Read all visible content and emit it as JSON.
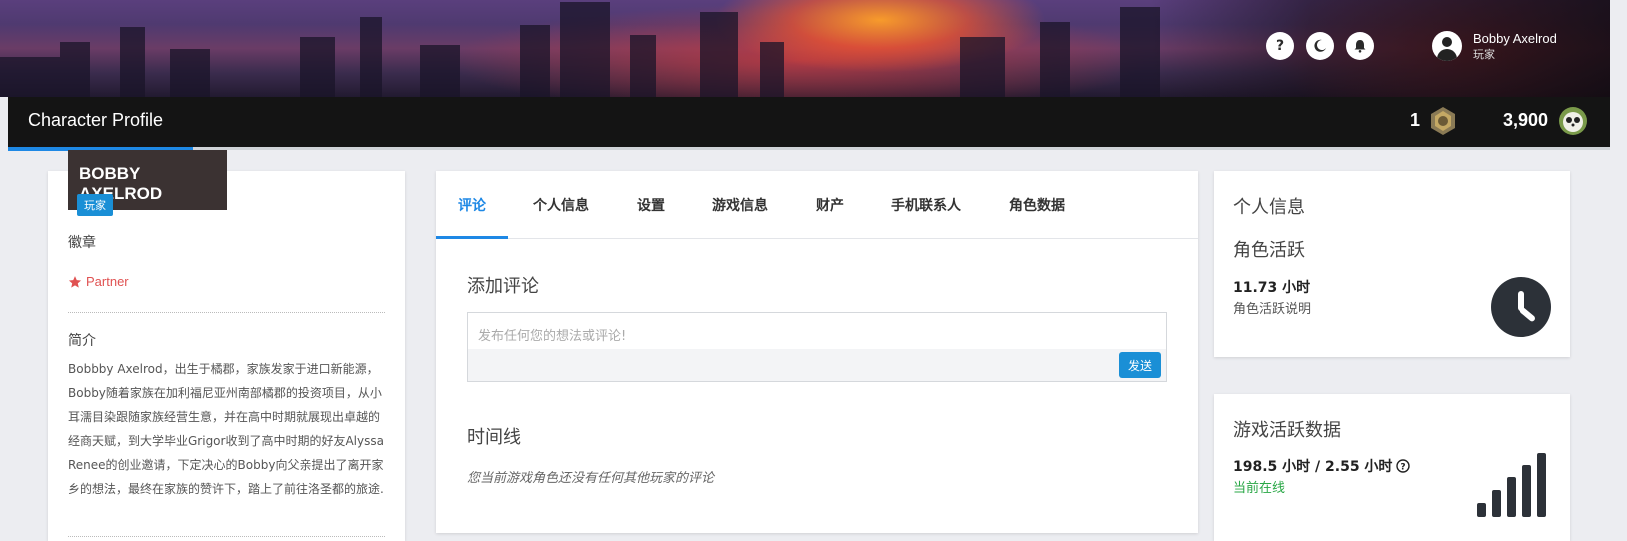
{
  "header": {
    "icons": [
      "question-icon",
      "moon-icon",
      "bell-icon"
    ],
    "user_name": "Bobby Axelrod",
    "user_role": "玩家"
  },
  "titlebar": {
    "title": "Character Profile",
    "badge_count": "1",
    "coins": "3,900"
  },
  "profile": {
    "name": "BOBBY AXELROD",
    "role_badge": "玩家",
    "badges_label": "徽章",
    "partner_label": "Partner",
    "intro_label": "简介",
    "bio": "Bobbby Axelrod，出生于橘郡，家族发家于进口新能源，Bobby随着家族在加利福尼亚州南部橘郡的投资项目，从小耳濡目染跟随家族经营生意，并在高中时期就展现出卓越的经商天赋，到大学毕业Grigor收到了高中时期的好友Alyssa Renee的创业邀请，下定决心的Bobby向父亲提出了离开家乡的想法，最终在家族的赞许下，踏上了前往洛圣都的旅途."
  },
  "tabs": [
    {
      "label": "评论"
    },
    {
      "label": "个人信息"
    },
    {
      "label": "设置"
    },
    {
      "label": "游戏信息"
    },
    {
      "label": "财产"
    },
    {
      "label": "手机联系人"
    },
    {
      "label": "角色数据"
    }
  ],
  "comments": {
    "add_heading": "添加评论",
    "placeholder": "发布任何您的想法或评论!",
    "send_label": "发送",
    "timeline_heading": "时间线",
    "empty_note": "您当前游戏角色还没有任何其他玩家的评论"
  },
  "personal_info": {
    "heading": "个人信息",
    "activity_heading": "角色活跃",
    "hours": "11.73 小时",
    "hours_desc": "角色活跃说明"
  },
  "game_activity": {
    "heading": "游戏活跃数据",
    "hours": "198.5 小时 / 2.55 小时",
    "status": "当前在线",
    "status_color": "#28a745",
    "signal_level": 1.0
  },
  "colors": {
    "accent": "#1e88e5",
    "badge": "#1a8fd6",
    "partner": "#e05252"
  }
}
